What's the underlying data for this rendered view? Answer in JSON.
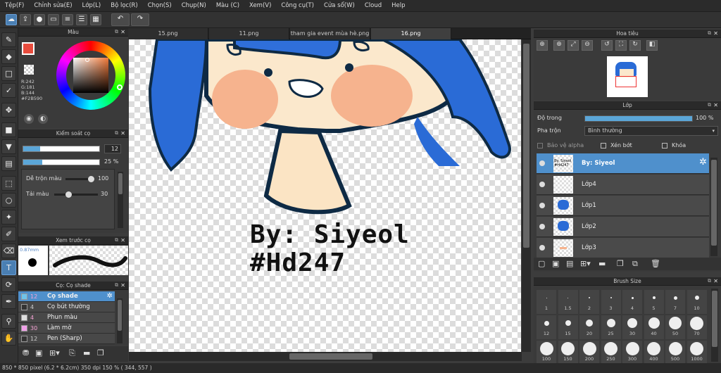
{
  "menu": [
    "Tệp(F)",
    "Chỉnh sửa(E)",
    "Lớp(L)",
    "Bộ lọc(R)",
    "Chọn(S)",
    "Chụp(N)",
    "Màu (C)",
    "Xem(V)",
    "Công cụ(T)",
    "Cửa sổ(W)",
    "Cloud",
    "Help"
  ],
  "tabs": [
    "15.png",
    "11.png",
    "tham gia event mùa hè.png",
    "16.png"
  ],
  "color_panel": {
    "title": "Màu",
    "r": "R:242",
    "g": "G:181",
    "b": "B:144",
    "hex": "#F2B590",
    "fg_color": "#e84c3d"
  },
  "brush_control": {
    "title": "Kiểm soát cọ",
    "size": "12",
    "opacity": "25 %",
    "opacity_fill": 0.25,
    "blend_label": "Dễ trộn màu",
    "blend_value": "100",
    "amount_label": "Tải màu",
    "amount_value": "30"
  },
  "brush_preview": {
    "title": "Xem trước cọ",
    "size": "0.87mm"
  },
  "brush_list": {
    "title": "Cọ: Cọ shade",
    "items": [
      {
        "num": "12",
        "label": "Cọ shade",
        "color": "#6ec3ea",
        "selected": true
      },
      {
        "num": "4",
        "label": "Cọ bút thường",
        "color": "#333333",
        "selected": false
      },
      {
        "num": "4",
        "label": "Phun màu",
        "color": "#dddddd",
        "selected": false
      },
      {
        "num": "30",
        "label": "Làm mờ",
        "color": "#f0a0e8",
        "selected": false
      },
      {
        "num": "12",
        "label": "Pen (Sharp)",
        "color": "#333333",
        "selected": false
      }
    ]
  },
  "canvas_text": {
    "line1": "By: Siyeol",
    "line2": "#Hd247"
  },
  "navigator": {
    "title": "Hoa tiêu"
  },
  "layers_panel": {
    "title": "Lớp",
    "opacity_label": "Độ trong",
    "opacity_value": "100 %",
    "opacity_fill": 1.0,
    "blend_label": "Pha trộn",
    "blend_value": "Bình thường",
    "protect_alpha": "Bảo vệ alpha",
    "clip": "Xén bớt",
    "lock": "Khóa",
    "layers": [
      {
        "name": "By: Siyeol",
        "selected": true
      },
      {
        "name": "Lớp4",
        "selected": false
      },
      {
        "name": "Lớp1",
        "selected": false
      },
      {
        "name": "Lớp2",
        "selected": false
      },
      {
        "name": "Lớp3",
        "selected": false
      }
    ]
  },
  "brush_size": {
    "title": "Brush Size",
    "row1": [
      "1",
      "1.5",
      "2",
      "3",
      "4",
      "5",
      "7",
      "10"
    ],
    "row2": [
      "12",
      "15",
      "20",
      "25",
      "30",
      "40",
      "50",
      "70"
    ],
    "row3": [
      "100",
      "150",
      "200",
      "250",
      "300",
      "400",
      "500",
      "1000"
    ]
  },
  "status": "850 * 850 pixel  (6.2 * 6.2cm)  350 dpi  150 %  ( 344, 557 )"
}
